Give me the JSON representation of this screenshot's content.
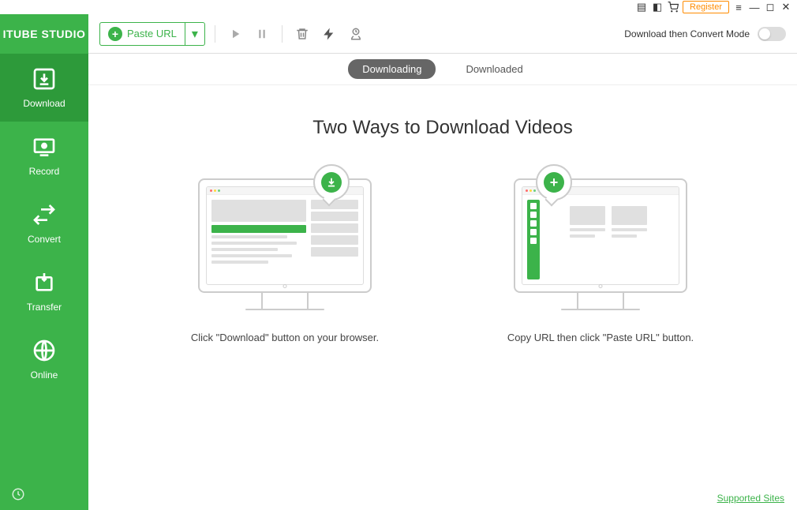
{
  "app": {
    "title": "ITUBE STUDIO"
  },
  "titlebar": {
    "register": "Register"
  },
  "sidebar": {
    "items": [
      {
        "label": "Download"
      },
      {
        "label": "Record"
      },
      {
        "label": "Convert"
      },
      {
        "label": "Transfer"
      },
      {
        "label": "Online"
      }
    ]
  },
  "toolbar": {
    "paste_url": "Paste URL",
    "convert_mode": "Download then Convert Mode"
  },
  "tabs": {
    "downloading": "Downloading",
    "downloaded": "Downloaded"
  },
  "content": {
    "title": "Two Ways to Download Videos",
    "way1": "Click \"Download\" button on your browser.",
    "way2": "Copy URL then click \"Paste URL\" button."
  },
  "footer": {
    "supported": "Supported Sites"
  }
}
